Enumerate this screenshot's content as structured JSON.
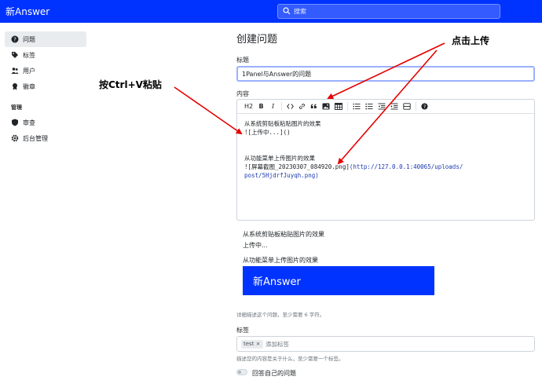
{
  "header": {
    "brand": "新Answer",
    "search_placeholder": "搜索"
  },
  "sidebar": {
    "items": [
      {
        "label": "问题",
        "icon": "question-circle-icon",
        "active": true
      },
      {
        "label": "标签",
        "icon": "tags-icon"
      },
      {
        "label": "用户",
        "icon": "people-icon"
      },
      {
        "label": "徽章",
        "icon": "award-icon"
      }
    ],
    "admin_heading": "管理",
    "admin_items": [
      {
        "label": "审查",
        "icon": "shield-icon"
      },
      {
        "label": "后台管理",
        "icon": "gear-icon"
      }
    ]
  },
  "form": {
    "page_title": "创建问题",
    "title_label": "标题",
    "title_value": "1Panel与Answer的问题",
    "content_label": "内容",
    "toolbar": {
      "heading": "H2",
      "bold": "B",
      "italic": "I"
    },
    "content_lines": [
      "从系统剪贴板粘贴图片的效果",
      "![上传中...]()",
      "",
      "",
      "从功能菜单上传图片的效果"
    ],
    "content_image_line": {
      "alt": "![屏幕截图_20230307_084920.png]",
      "url_line1": "(http://127.0.0.1:40065/uploads/",
      "url_line2": "post/5HjdrfJuyqh.png)"
    },
    "preview": {
      "line1": "从系统剪贴板粘贴图片的效果",
      "line2": "上传中...",
      "line3": "从功能菜单上传图片的效果",
      "image_text": "新Answer"
    },
    "content_hint": "详细描述这个问题，至少需要 6 字符。",
    "tags_label": "标签",
    "tag_chip": "test ×",
    "tag_placeholder": "添加标签",
    "tags_hint": "描述您的内容是关于什么，至少需要一个标签。",
    "answer_own_label": "回答自己的问题"
  },
  "annotations": {
    "ctrl_v": "按Ctrl+V粘贴",
    "click_upload": "点击上传"
  },
  "colors": {
    "brand": "#0033ff",
    "arrow": "#e60000"
  }
}
